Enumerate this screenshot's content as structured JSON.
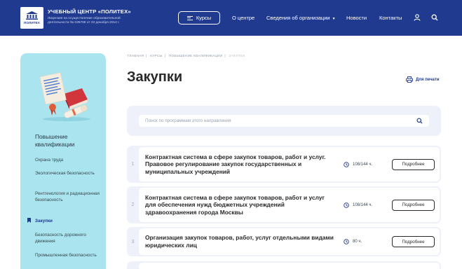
{
  "header": {
    "logo_text": "ПОЛИТЕХ",
    "logo_subtext": "учебный центр",
    "brand_title": "УЧЕБНЫЙ ЦЕНТР «ПОЛИТЕХ»",
    "brand_subtitle": "Лицензия на осуществление образовательной деятельности № 035788 от 23 декабря 2014 г.",
    "courses_button": "Курсы",
    "nav": [
      "О центре",
      "Сведения об организации",
      "Новости",
      "Контакты"
    ],
    "icons": [
      "user-icon",
      "search-icon",
      "menu-icon",
      "chevron-down-icon"
    ],
    "colors": {
      "primary": "#1f3a8f",
      "sidebar": "#a9e4ef",
      "panel": "#eef1fa"
    }
  },
  "sidebar": {
    "title": "Повышение квалификации",
    "items": [
      "Охрана труда",
      "Экологическая безопасность",
      "Рентгенология и радиационная безопасность",
      "Закупки",
      "Безопасность дорожного движения",
      "Промышленная безопасность"
    ],
    "active_index": 3
  },
  "breadcrumb": [
    "ГЛАВНАЯ",
    "КУРСЫ",
    "ПОВЫШЕНИЕ КВАЛИФИКАЦИИ",
    "ЗАКУПКИ"
  ],
  "page_title": "Закупки",
  "print_label": "Для печати",
  "search": {
    "placeholder": "Поиск по программам этого направления",
    "value": ""
  },
  "courses": [
    {
      "num": "1",
      "title": "Контрактная система в сфере закупок товаров, работ и услуг. Правовое регулирование закупок государственных и муниципальных учреждений",
      "hours": "108/144 ч.",
      "button": "Подробнее"
    },
    {
      "num": "2",
      "title": "Контрактная система в сфере закупок товаров, работ и услуг для обеспечения нужд бюджетных учреждений здравоохранения города Москвы",
      "hours": "108/144 ч.",
      "button": "Подробнее"
    },
    {
      "num": "3",
      "title": "Организация закупок товаров, работ, услуг отдельными видами юридических лиц",
      "hours": "80 ч.",
      "button": "Подробнее"
    }
  ]
}
